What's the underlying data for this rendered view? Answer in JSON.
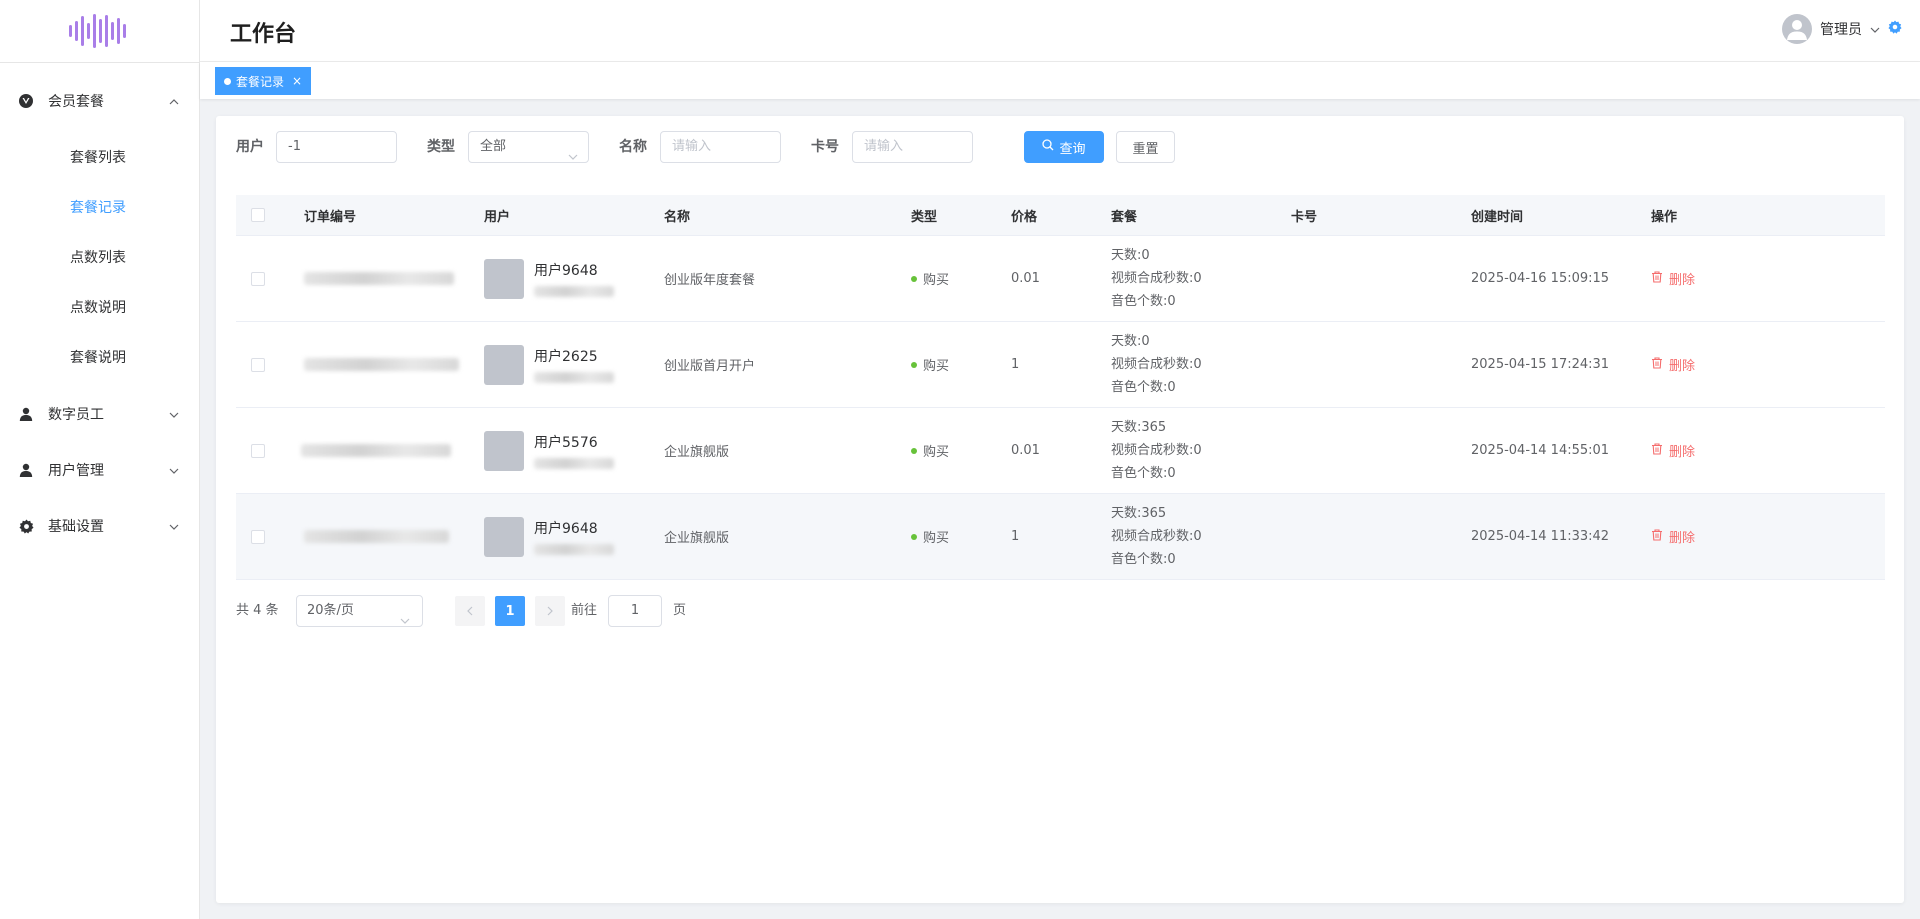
{
  "app": {
    "page_title": "工作台",
    "user_label": "管理员"
  },
  "sidebar": {
    "groups": [
      {
        "label": "会员套餐",
        "icon": "vue-logo-icon",
        "expanded": true,
        "items": [
          {
            "label": "套餐列表",
            "active": false
          },
          {
            "label": "套餐记录",
            "active": true
          },
          {
            "label": "点数列表",
            "active": false
          },
          {
            "label": "点数说明",
            "active": false
          },
          {
            "label": "套餐说明",
            "active": false
          }
        ]
      },
      {
        "label": "数字员工",
        "icon": "user-icon",
        "expanded": false
      },
      {
        "label": "用户管理",
        "icon": "user-icon",
        "expanded": false
      },
      {
        "label": "基础设置",
        "icon": "gear-icon",
        "expanded": false
      }
    ]
  },
  "tags": [
    {
      "label": "套餐记录",
      "active": true
    }
  ],
  "filters": {
    "user_label": "用户",
    "user_value": "-1",
    "type_label": "类型",
    "type_value": "全部",
    "name_label": "名称",
    "name_placeholder": "请输入",
    "card_label": "卡号",
    "card_placeholder": "请输入",
    "search_button": "查询",
    "reset_button": "重置"
  },
  "table": {
    "columns": [
      "订单编号",
      "用户",
      "名称",
      "类型",
      "价格",
      "套餐",
      "卡号",
      "创建时间",
      "操作"
    ],
    "rows": [
      {
        "user": "用户9648",
        "name": "创业版年度套餐",
        "type": "购买",
        "price": "0.01",
        "pkg": [
          "天数:0",
          "视频合成秒数:0",
          "音色个数:0"
        ],
        "card": "",
        "time": "2025-04-16 15:09:15",
        "op": "删除"
      },
      {
        "user": "用户2625",
        "name": "创业版首月开户",
        "type": "购买",
        "price": "1",
        "pkg": [
          "天数:0",
          "视频合成秒数:0",
          "音色个数:0"
        ],
        "card": "",
        "time": "2025-04-15 17:24:31",
        "op": "删除"
      },
      {
        "user": "用户5576",
        "name": "企业旗舰版",
        "type": "购买",
        "price": "0.01",
        "pkg": [
          "天数:365",
          "视频合成秒数:0",
          "音色个数:0"
        ],
        "card": "",
        "time": "2025-04-14 14:55:01",
        "op": "删除"
      },
      {
        "user": "用户9648",
        "name": "企业旗舰版",
        "type": "购买",
        "price": "1",
        "pkg": [
          "天数:365",
          "视频合成秒数:0",
          "音色个数:0"
        ],
        "card": "",
        "time": "2025-04-14 11:33:42",
        "op": "删除"
      }
    ]
  },
  "pagination": {
    "total_text": "共 4 条",
    "page_size": "20条/页",
    "current_page": "1",
    "goto_label": "前往",
    "goto_value": "1",
    "page_suffix": "页"
  },
  "colors": {
    "primary": "#409eff",
    "danger": "#f56c6c",
    "success": "#67c23a",
    "logo": "#a97ee8"
  }
}
